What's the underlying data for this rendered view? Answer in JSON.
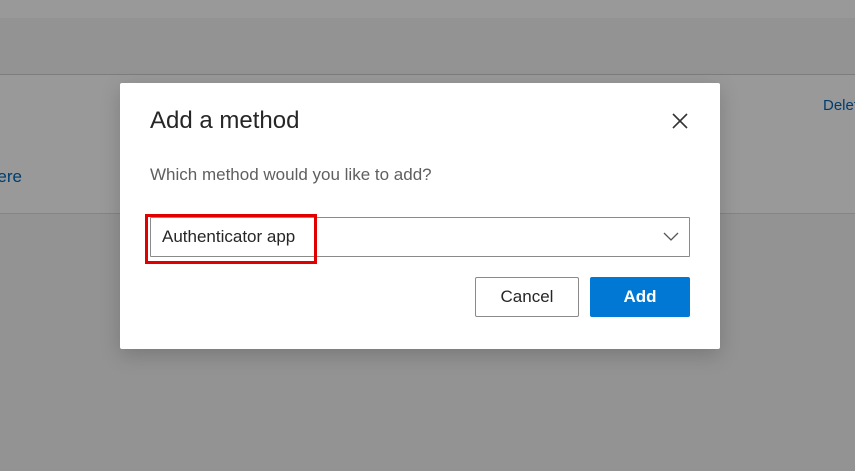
{
  "background": {
    "delete_link": "Delete",
    "row_link": "here"
  },
  "dialog": {
    "title": "Add a method",
    "question": "Which method would you like to add?",
    "method_select": {
      "selected": "Authenticator app"
    },
    "cancel_label": "Cancel",
    "add_label": "Add",
    "close_icon": "close-icon",
    "chevron_icon": "chevron-down-icon"
  },
  "colors": {
    "accent": "#0078d4",
    "link": "#0067b8",
    "highlight": "#e00000"
  }
}
